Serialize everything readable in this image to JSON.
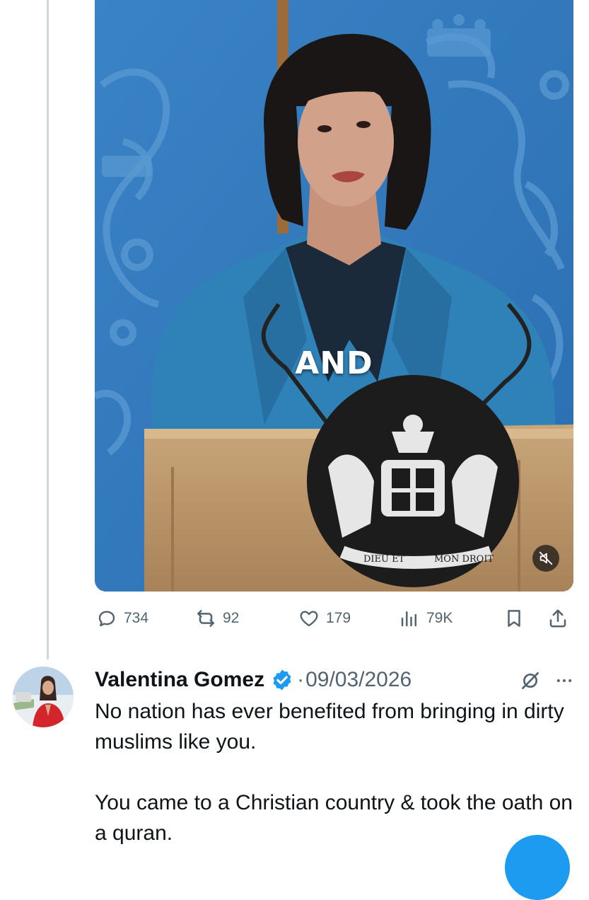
{
  "media": {
    "caption": "AND",
    "lectern_motto_left": "DIEU ET",
    "lectern_motto_right": "MON DROIT",
    "mute_icon": "speaker-muted-icon"
  },
  "actions": {
    "reply_count": "734",
    "repost_count": "92",
    "like_count": "179",
    "views_count": "79K"
  },
  "tweet": {
    "author_name": "Valentina Gomez",
    "date": "09/03/2026",
    "separator": "·",
    "body": "No nation has ever benefited from bringing in dirty muslims like you.\n\nYou came to a Christian country & took the oath on a quran."
  },
  "colors": {
    "accent": "#1d9bf0",
    "muted_text": "#536471",
    "thread_line": "#cfd9de",
    "backdrop_blue": "#2d73b8"
  }
}
